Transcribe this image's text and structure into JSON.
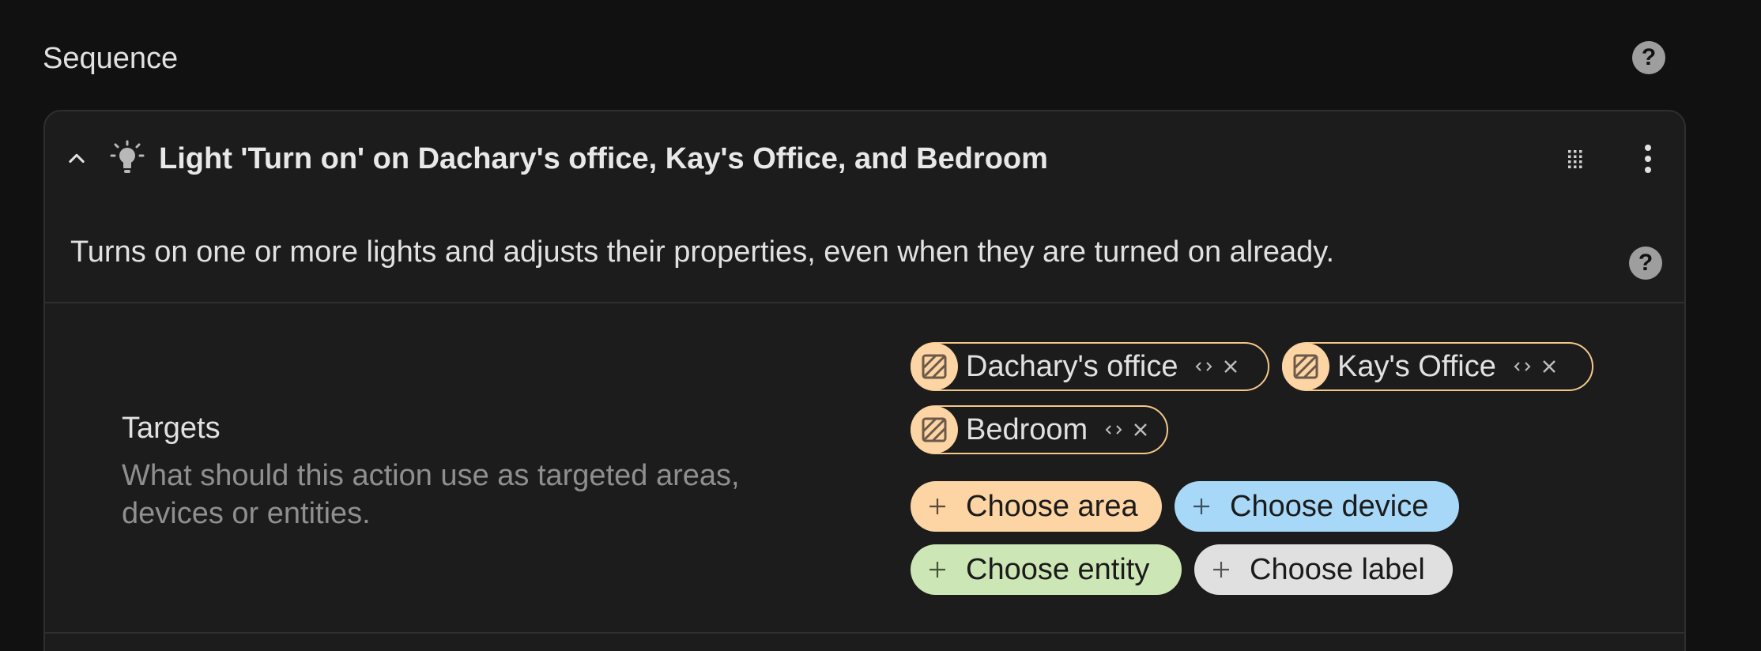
{
  "section": {
    "title": "Sequence"
  },
  "action": {
    "title": "Light 'Turn on' on Dachary's office, Kay's Office, and Bedroom",
    "description": "Turns on one or more lights and adjusts their properties, even when they are turned on already."
  },
  "targets": {
    "label": "Targets",
    "description": "What should this action use as targeted areas, devices or entities.",
    "chips": [
      {
        "label": "Dachary's office",
        "icon": "area-icon"
      },
      {
        "label": "Kay's Office",
        "icon": "area-icon"
      },
      {
        "label": "Bedroom",
        "icon": "area-icon"
      }
    ],
    "pickers": [
      {
        "label": "Choose area",
        "color": "#fdd4a3"
      },
      {
        "label": "Choose device",
        "color": "#a8d8f8"
      },
      {
        "label": "Choose entity",
        "color": "#cde6b5"
      },
      {
        "label": "Choose label",
        "color": "#e0e0e0"
      }
    ]
  },
  "help": {
    "glyph": "?"
  },
  "colors": {
    "background": "#111111",
    "card": "#1c1c1c",
    "area_chip_border": "#f4c889",
    "area_avatar": "#fdd4a3"
  }
}
